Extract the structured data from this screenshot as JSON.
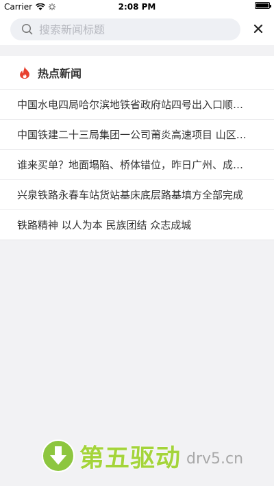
{
  "status_bar": {
    "carrier": "Carrier",
    "time": "2:08 PM"
  },
  "search": {
    "placeholder": "搜索新闻标题",
    "value": ""
  },
  "hot_news": {
    "title": "热点新闻",
    "items": [
      "中国水电四局哈尔滨地铁省政府站四号出入口顺利封顶",
      "中国铁建二十三局集团一公司莆炎高速项目 山区施工进展顺利",
      "谁来买单？地面塌陷、桥体错位，昨日广州、成都多地发生事故",
      "兴泉铁路永春车站货站基床底层路基填方全部完成",
      "铁路精神 以人为本 民族团结 众志成城"
    ]
  },
  "watermark": {
    "brand_cn": "第五驱动",
    "brand_en": "drv5.cn"
  },
  "colors": {
    "fire": "#e8402e",
    "brand_green": "#8dc63f",
    "search_bg": "#eef0f4"
  }
}
